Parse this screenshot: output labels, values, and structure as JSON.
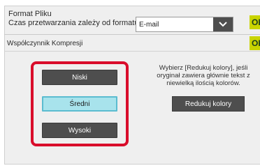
{
  "format": {
    "title": "Format Pliku",
    "note": "Czas przetwarzania zależy od formatu.",
    "selected_value": "E-mail",
    "icon": "chevron-down-icon"
  },
  "ok_label": "OK",
  "compression": {
    "label": "Współczynnik Kompresji",
    "options": [
      "Niski",
      "Średni",
      "Wysoki"
    ],
    "selected": "Średni",
    "help_text": "Wybierz [Redukuj kolory], jeśli oryginał zawiera głównie tekst z niewielką ilością kolorów.",
    "reduce_button": "Redukuj kolory"
  },
  "colors": {
    "highlight_frame": "#d90d2b",
    "ok_button": "#c9d400",
    "selected_option": "#a8e3ec",
    "button": "#4e4e4e"
  }
}
